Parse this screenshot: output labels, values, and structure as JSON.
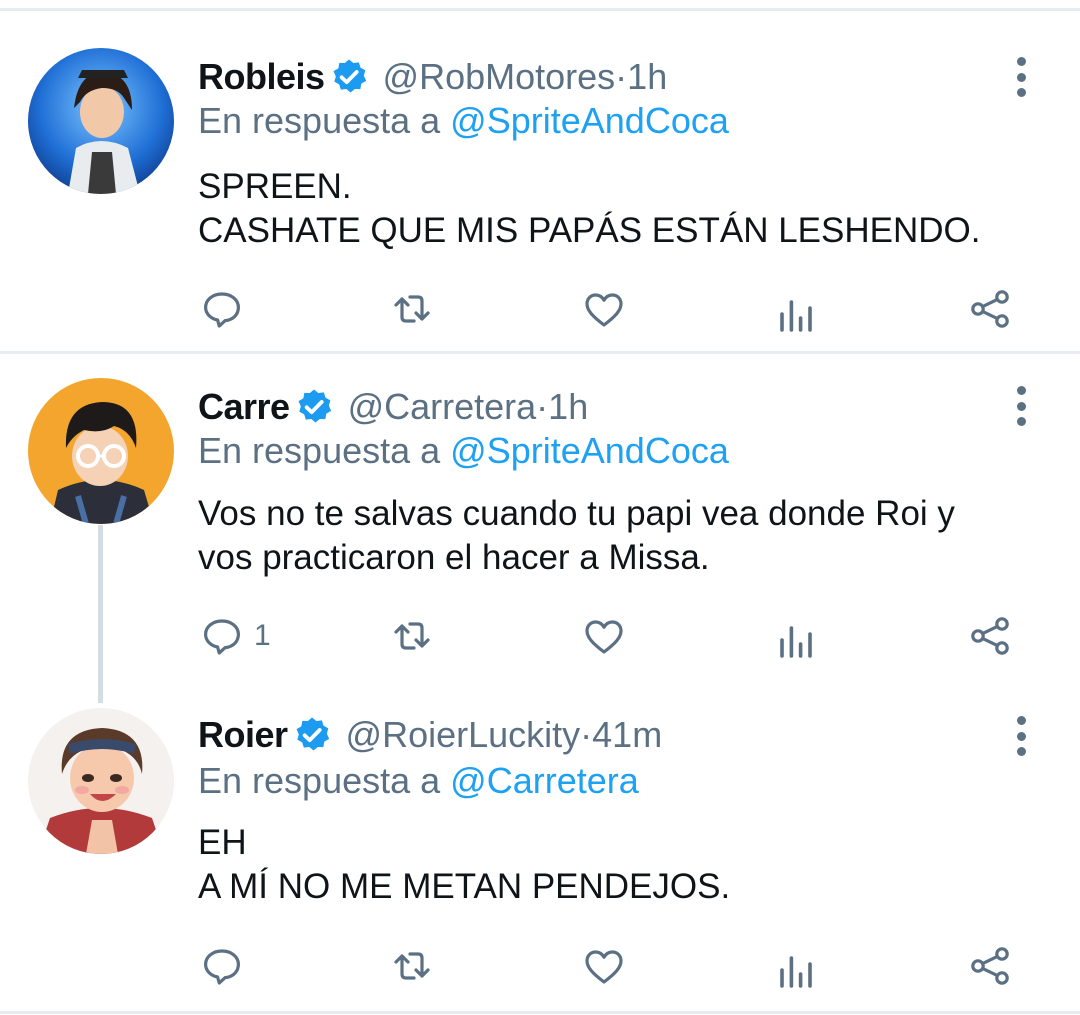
{
  "tweets": [
    {
      "name": "Robleis",
      "handle": "@RobMotores",
      "time": "1h",
      "reply_prefix": "En respuesta a ",
      "reply_mention": "@SpriteAndCoca",
      "text_lines": [
        "SPREEN.",
        "CASHATE QUE MIS PAPÁS ESTÁN LESHENDO."
      ],
      "reply_count": "",
      "verified": true
    },
    {
      "name": "Carre",
      "handle": "@Carretera",
      "time": "1h",
      "reply_prefix": "En respuesta a ",
      "reply_mention": "@SpriteAndCoca",
      "text_lines": [
        "Vos no te salvas cuando tu papi vea donde Roi y",
        "vos practicaron el hacer a Missa."
      ],
      "reply_count": "1",
      "verified": true
    },
    {
      "name": "Roier",
      "handle": "@RoierLuckity",
      "time": "41m",
      "reply_prefix": "En respuesta a ",
      "reply_mention": "@Carretera",
      "text_lines": [
        "EH",
        "A MÍ NO ME METAN PENDEJOS."
      ],
      "reply_count": "",
      "verified": true
    }
  ],
  "separator": " · ",
  "icons": {
    "reply": "reply-icon",
    "retweet": "retweet-icon",
    "like": "like-icon",
    "stats": "stats-icon",
    "share": "share-icon",
    "verified": "verified-badge-icon",
    "more": "more-options-icon"
  },
  "colors": {
    "name": "#0f1419",
    "secondary": "#5b7083",
    "mention": "#1da1f2",
    "verified": "#1d9bf0",
    "divider": "#e6ecf0"
  }
}
